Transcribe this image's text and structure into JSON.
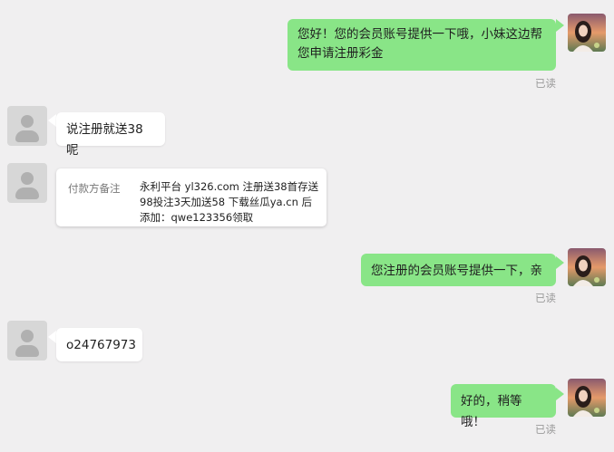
{
  "messages": {
    "m1": {
      "text": "您好！您的会员账号提供一下哦，小妹这边帮您申请注册彩金",
      "status": "已读"
    },
    "m2": {
      "text": "说注册就送38呢"
    },
    "m3": {
      "label": "付款方备注",
      "note": "永利平台 yl326.com 注册送38首存送98投注3天加送58 下载丝瓜ya.cn 后添加：qwe123356领取"
    },
    "m4": {
      "text": "您注册的会员账号提供一下，亲",
      "status": "已读"
    },
    "m5": {
      "text": "o24767973"
    },
    "m6": {
      "text": "好的，稍等哦！",
      "status": "已读"
    }
  },
  "colors": {
    "background": "#f0eff0",
    "self_bubble": "#89e587",
    "other_bubble": "#ffffff",
    "read_status": "#9a9a9a"
  }
}
